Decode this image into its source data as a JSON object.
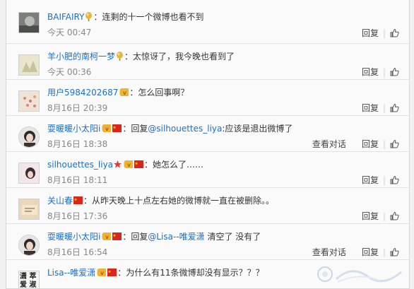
{
  "comments": [
    {
      "user": "BAIFAIRY",
      "badges": [
        "balloon-icon"
      ],
      "text": "：连剩的十一个微博也看不到",
      "date": "今天 00:47",
      "reply": "回复",
      "avatar": "photo-dark",
      "round": false
    },
    {
      "user": "羊小肥的南柯一梦",
      "badges": [
        "balloon-icon"
      ],
      "text": "：太惊讶了，我今晚也看到了",
      "date": "今天 00:36",
      "reply": "回复",
      "avatar": "photo-light",
      "round": false
    },
    {
      "user": "用户5984202687",
      "badges": [
        "vip-icon"
      ],
      "text": "：怎么回事啊？",
      "date": "8月16日 20:39",
      "reply": "回复",
      "avatar": "photo-dots",
      "round": false
    },
    {
      "user": "耍暖暖小太阳i",
      "badges": [
        "vip-icon",
        "flag-icon"
      ],
      "text_prefix": "：回复",
      "mention": "@silhouettes_liya",
      "text": ":应该是退出微博了",
      "date": "8月16日 18:38",
      "conversation": "查看对话",
      "reply": "回复",
      "avatar": "photo-girl",
      "round": true
    },
    {
      "user": "silhouettes_liya",
      "badges": [
        "star-icon",
        "vip-icon",
        "flag-icon"
      ],
      "text": "：她怎么了……",
      "date": "8月16日 18:11",
      "reply": "回复",
      "avatar": "photo-pink",
      "round": false
    },
    {
      "user": "关山春",
      "badges": [
        "flag-icon"
      ],
      "text": "：从昨天晚上十点左右她的微博就一直在被删除。。",
      "date": "8月16日 17:36",
      "reply": "回复",
      "avatar": "photo-tan",
      "round": false
    },
    {
      "user": "耍暖暖小太阳i",
      "badges": [
        "vip-icon",
        "flag-icon"
      ],
      "text_prefix": "：回复",
      "mention": "@Lisa--唯爱潇",
      "text": " 清空了 没有了",
      "date": "8月16日 16:54",
      "conversation": "查看对话",
      "reply": "回复",
      "avatar": "photo-girl",
      "round": true
    },
    {
      "user": "Lisa--唯爱潇",
      "badges": [
        "vip-icon",
        "flag-icon"
      ],
      "text": "：为什么有11条微博却没有显示？？？",
      "date": "",
      "reply": "",
      "avatar_text": "潇 萃 爱 淑",
      "avatar": "photo-text",
      "round": false
    }
  ],
  "colors": {
    "link": "#1f6fbf",
    "text": "#333333",
    "muted": "#888888",
    "flag": "#d9261c"
  }
}
